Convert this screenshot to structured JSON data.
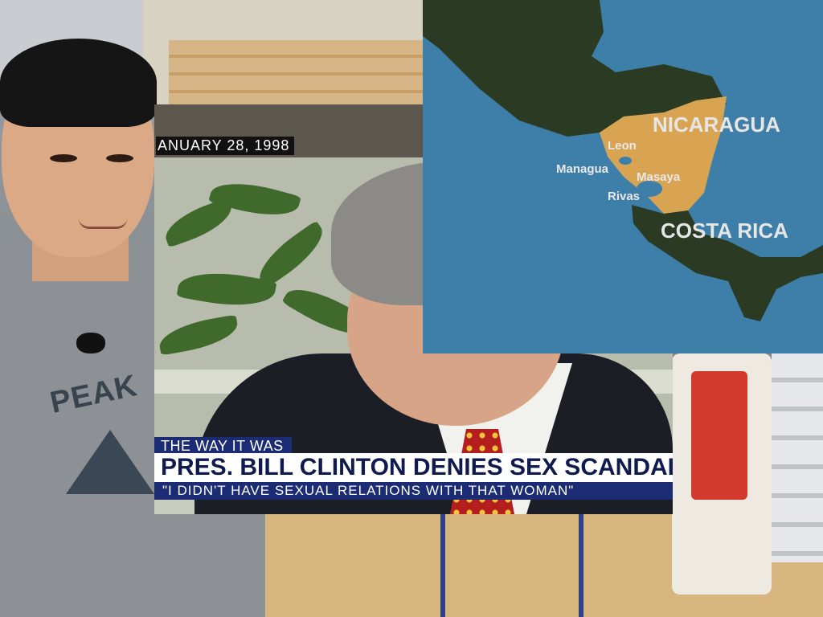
{
  "news": {
    "date": "ANUARY 28, 1998",
    "segment": "THE WAY IT WAS",
    "headline": "PRES. BILL CLINTON DENIES SEX SCANDAL",
    "quote": "\"I DIDN'T HAVE SEXUAL RELATIONS WITH THAT WOMAN\""
  },
  "map": {
    "countries": [
      "NICARAGUA",
      "COSTA RICA"
    ],
    "cities": [
      "Leon",
      "Managua",
      "Masaya",
      "Rivas"
    ],
    "colors": {
      "sea": "#3e7faa",
      "land": "#2b3a22",
      "highlight": "#d9a452"
    }
  },
  "store": {
    "shirt_text": "PEAK"
  }
}
